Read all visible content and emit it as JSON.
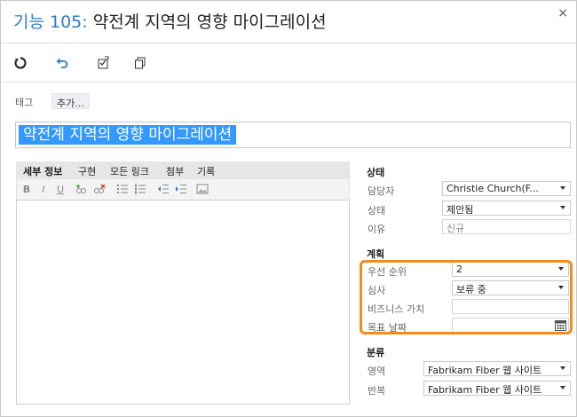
{
  "window": {
    "title_prefix": "기능 105",
    "title_separator": ":",
    "title_text": "약전계 지역의 영향 마이그레이션",
    "close_glyph": "×"
  },
  "toolbar": {
    "icons": [
      "refresh-icon",
      "undo-icon",
      "work-item-action-icon",
      "copy-icon"
    ]
  },
  "tags": {
    "label": "태그",
    "add_label": "추가..."
  },
  "title_field": {
    "value": "약전계 지역의 영향 마이그레이션"
  },
  "tabs": [
    {
      "label": "세부 정보",
      "active": true
    },
    {
      "label": "구현",
      "active": false
    },
    {
      "label": "모든 링크",
      "active": false
    },
    {
      "label": "첨부",
      "active": false
    },
    {
      "label": "기록",
      "active": false
    }
  ],
  "formatting": {
    "bold": "B",
    "italic": "I",
    "underline": "U"
  },
  "status": {
    "section_label": "상태",
    "assigned_to": {
      "label": "담당자",
      "value": "Christie Church(F..."
    },
    "state": {
      "label": "상태",
      "value": "제안됨"
    },
    "reason": {
      "label": "이유",
      "value": "신규"
    }
  },
  "planning": {
    "section_label": "계획",
    "priority": {
      "label": "우선 순위",
      "value": "2"
    },
    "review": {
      "label": "심사",
      "value": "보류 중"
    },
    "business_value": {
      "label": "비즈니스 가치",
      "value": ""
    },
    "target_date": {
      "label": "목표 날짜",
      "value": ""
    }
  },
  "classification": {
    "section_label": "분류",
    "area": {
      "label": "영역",
      "value": "Fabrikam Fiber 웹 사이트"
    },
    "iteration": {
      "label": "반복",
      "value": "Fabrikam Fiber 웹 사이트"
    }
  },
  "colors": {
    "accent_blue": "#2b7bc4",
    "selection_blue": "#3399ff",
    "highlight_orange": "#f28c1e"
  }
}
